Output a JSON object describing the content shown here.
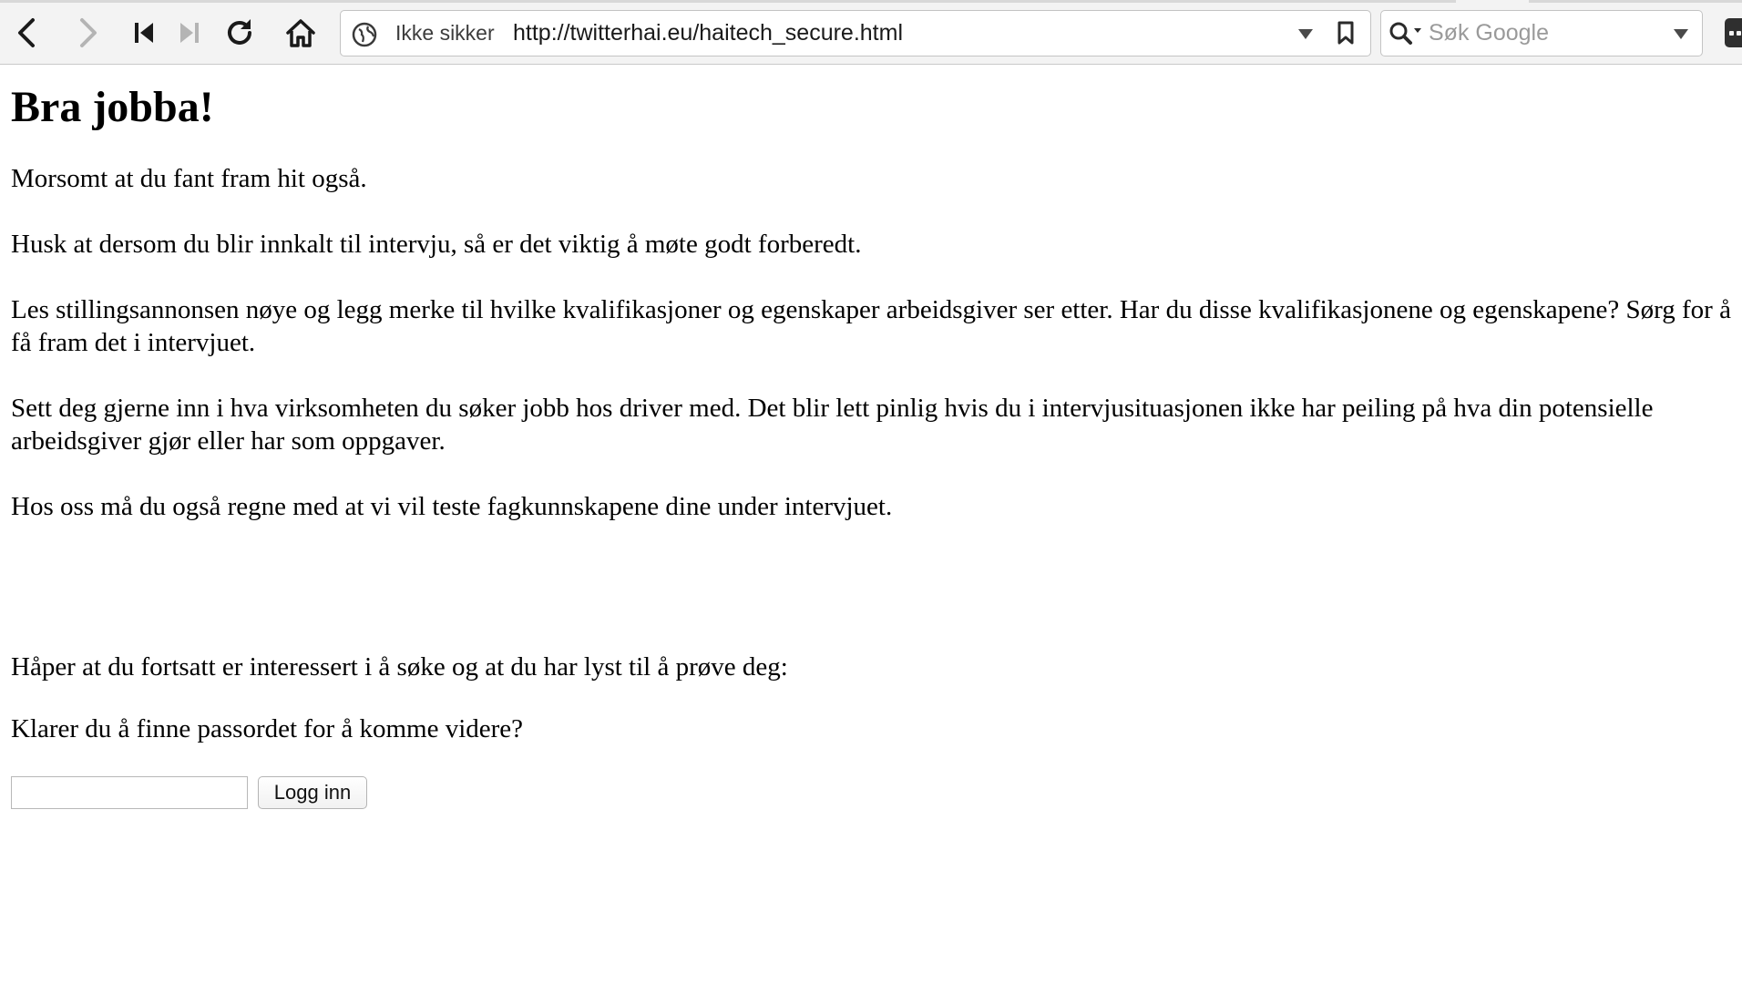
{
  "browser": {
    "security_label": "Ikke sikker",
    "url": "http://twitterhai.eu/haitech_secure.html",
    "search_placeholder": "Søk Google",
    "icons": [
      "back-icon",
      "forward-icon",
      "skip-back-icon",
      "skip-forward-icon",
      "reload-icon",
      "home-icon",
      "globe-icon",
      "dropdown-icon",
      "bookmark-icon",
      "search-icon",
      "extension-icon"
    ]
  },
  "page": {
    "heading": "Bra jobba!",
    "paragraphs": [
      "Morsomt at du fant fram hit også.",
      "Husk at dersom du blir innkalt til intervju, så er det viktig å møte godt forberedt.",
      "Les stillingsannonsen nøye og legg merke til hvilke kvalifikasjoner og egenskaper arbeidsgiver ser etter. Har du disse kvalifikasjonene og egenskapene? Sørg for å få fram det i intervjuet.",
      "Sett deg gjerne inn i hva virksomheten du søker jobb hos driver med. Det blir lett pinlig hvis du i intervjusituasjonen ikke har peiling på hva din potensielle arbeidsgiver gjør eller har som oppgaver.",
      "Hos oss må du også regne med at vi vil teste fagkunnskapene dine under intervjuet.",
      "Håper at du fortsatt er interessert i å søke og at du har lyst til å prøve deg:",
      "Klarer du å finne passordet for å komme videre?"
    ],
    "password_value": "",
    "login_button": "Logg inn"
  }
}
